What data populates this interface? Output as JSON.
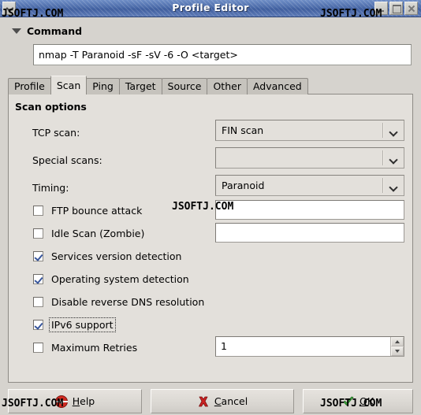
{
  "window": {
    "title": "Profile Editor",
    "menu_icon": "window-menu-chevron-icon",
    "minimize_icon": "minimize-icon",
    "maximize_icon": "maximize-icon",
    "close_icon": "close-icon"
  },
  "expander": {
    "label": "Command",
    "expanded": true
  },
  "command": {
    "value": "nmap -T Paranoid -sF -sV -6 -O <target>"
  },
  "tabs": [
    {
      "label": "Profile",
      "active": false
    },
    {
      "label": "Scan",
      "active": true
    },
    {
      "label": "Ping",
      "active": false
    },
    {
      "label": "Target",
      "active": false
    },
    {
      "label": "Source",
      "active": false
    },
    {
      "label": "Other",
      "active": false
    },
    {
      "label": "Advanced",
      "active": false
    }
  ],
  "scan_page": {
    "section_title": "Scan options",
    "combos": [
      {
        "label": "TCP scan:",
        "value": "FIN scan"
      },
      {
        "label": "Special scans:",
        "value": ""
      },
      {
        "label": "Timing:",
        "value": "Paranoid"
      }
    ],
    "checkboxes": [
      {
        "label": "FTP bounce attack",
        "checked": false,
        "focused": false
      },
      {
        "label": "Idle Scan (Zombie)",
        "checked": false,
        "focused": false
      },
      {
        "label": "Services version detection",
        "checked": true,
        "focused": false
      },
      {
        "label": "Operating system detection",
        "checked": true,
        "focused": false
      },
      {
        "label": "Disable reverse DNS resolution",
        "checked": false,
        "focused": false
      },
      {
        "label": "IPv6 support",
        "checked": true,
        "focused": true
      },
      {
        "label": "Maximum Retries",
        "checked": false,
        "focused": false
      }
    ],
    "ftp_bounce_entry": "",
    "idle_scan_entry": "",
    "max_retries_value": "1"
  },
  "buttons": {
    "help": {
      "pre": "",
      "mnemonic": "H",
      "post": "elp",
      "icon": "lifesaver-icon"
    },
    "cancel": {
      "pre": "",
      "mnemonic": "C",
      "post": "ancel",
      "icon": "red-x-icon"
    },
    "ok": {
      "pre": "",
      "mnemonic": "O",
      "post": "K",
      "icon": "green-check-icon"
    }
  },
  "watermark": {
    "text": "JSOFTJ.COM"
  },
  "colors": {
    "titlebar_blue": "#4a6aa8",
    "face": "#d6d3ce",
    "page": "#e3e0db",
    "check_blue": "#37559b",
    "ok_green": "#3faa3f",
    "cancel_red": "#cc2222"
  }
}
